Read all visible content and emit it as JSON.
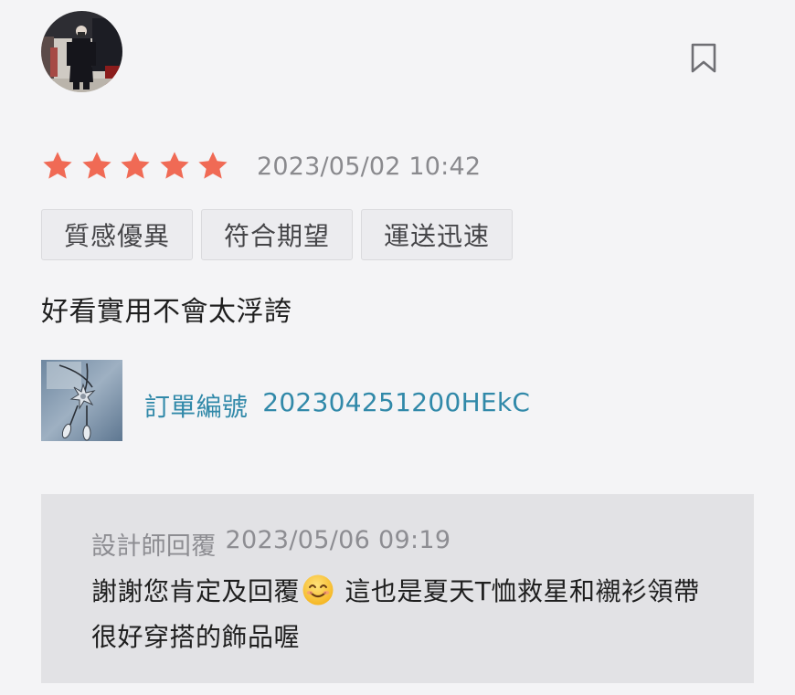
{
  "review": {
    "avatar_icon": "user-photo-avatar",
    "bookmark_icon": "bookmark-icon",
    "rating": 5,
    "rating_max": 5,
    "star_color": "#f06a55",
    "date": "2023/05/02 10:42",
    "tags": [
      "質感優異",
      "符合期望",
      "運送迅速"
    ],
    "text": "好看實用不會太浮誇"
  },
  "order": {
    "thumb_icon": "product-thumbnail-brooch",
    "label": "訂單編號",
    "number": "202304251200HEkC",
    "link_color": "#3189a9"
  },
  "reply": {
    "author_label": "設計師回覆",
    "date": "2023/05/06 09:19",
    "text_before_emoji": "謝謝您肯定及回覆",
    "emoji_icon": "smiling-face-emoji",
    "text_after_emoji": " 這也是夏天T恤救星和襯衫領帶很好穿搭的飾品喔"
  }
}
